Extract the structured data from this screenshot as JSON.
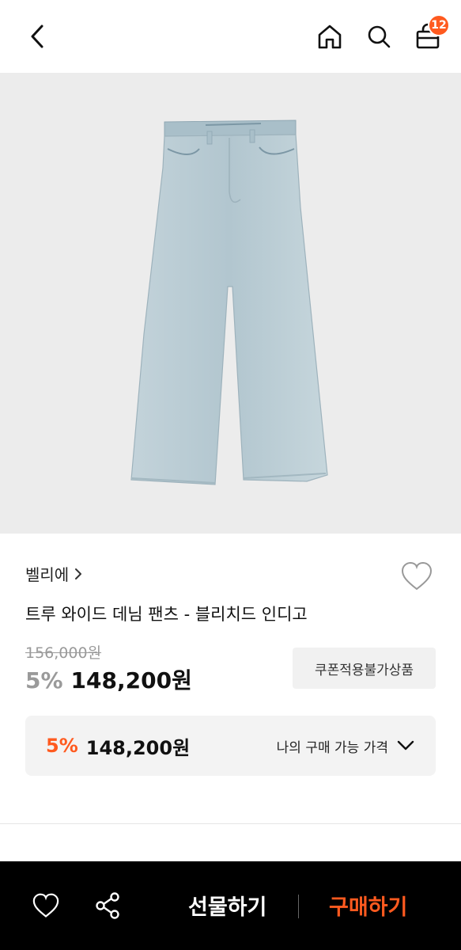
{
  "header": {
    "cart_count": "12"
  },
  "product": {
    "brand": "벨리에",
    "name": "트루 와이드 데님 팬츠 - 블리치드 인디고",
    "original_price": "156,000원",
    "discount_pct": "5%",
    "price": "148,200원",
    "coupon_label": "쿠폰적용불가상품"
  },
  "my_price": {
    "discount_pct": "5%",
    "price": "148,200원",
    "label": "나의 구매 가능 가격"
  },
  "bottom_bar": {
    "gift_label": "선물하기",
    "buy_label": "구매하기"
  },
  "colors": {
    "accent": "#ff5a1f",
    "denim": "#b9cbd3"
  }
}
